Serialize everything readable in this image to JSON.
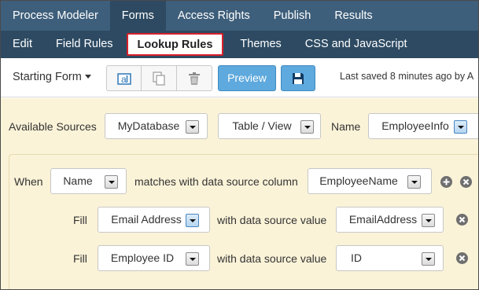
{
  "topnav": {
    "items": [
      {
        "label": "Process Modeler"
      },
      {
        "label": "Forms"
      },
      {
        "label": "Access Rights"
      },
      {
        "label": "Publish"
      },
      {
        "label": "Results"
      }
    ]
  },
  "subnav": {
    "items": [
      {
        "label": "Edit"
      },
      {
        "label": "Field Rules"
      },
      {
        "label": "Lookup Rules"
      },
      {
        "label": "Themes"
      },
      {
        "label": "CSS and JavaScript"
      }
    ]
  },
  "toolbar": {
    "starting_form": "Starting Form",
    "preview": "Preview",
    "last_saved": "Last saved 8 minutes ago by A"
  },
  "sources": {
    "label": "Available Sources",
    "database": "MyDatabase",
    "type": "Table / View",
    "name_label": "Name",
    "name_value": "EmployeeInfo"
  },
  "rule": {
    "when_label": "When",
    "when_field": "Name",
    "matches_text": "matches with data source column",
    "column": "EmployeeName",
    "fills": [
      {
        "fill_label": "Fill",
        "field": "Email Address",
        "with_text": "with data source value",
        "value": "EmailAddress"
      },
      {
        "fill_label": "Fill",
        "field": "Employee ID",
        "with_text": "with data source value",
        "value": "ID"
      }
    ]
  },
  "colors": {
    "topnav_bg": "#3e5f7b",
    "subnav_bg": "#2d4a62",
    "highlight_border": "#d9202a",
    "button_blue": "#5ea9dd",
    "content_bg": "#fbf3d8"
  }
}
